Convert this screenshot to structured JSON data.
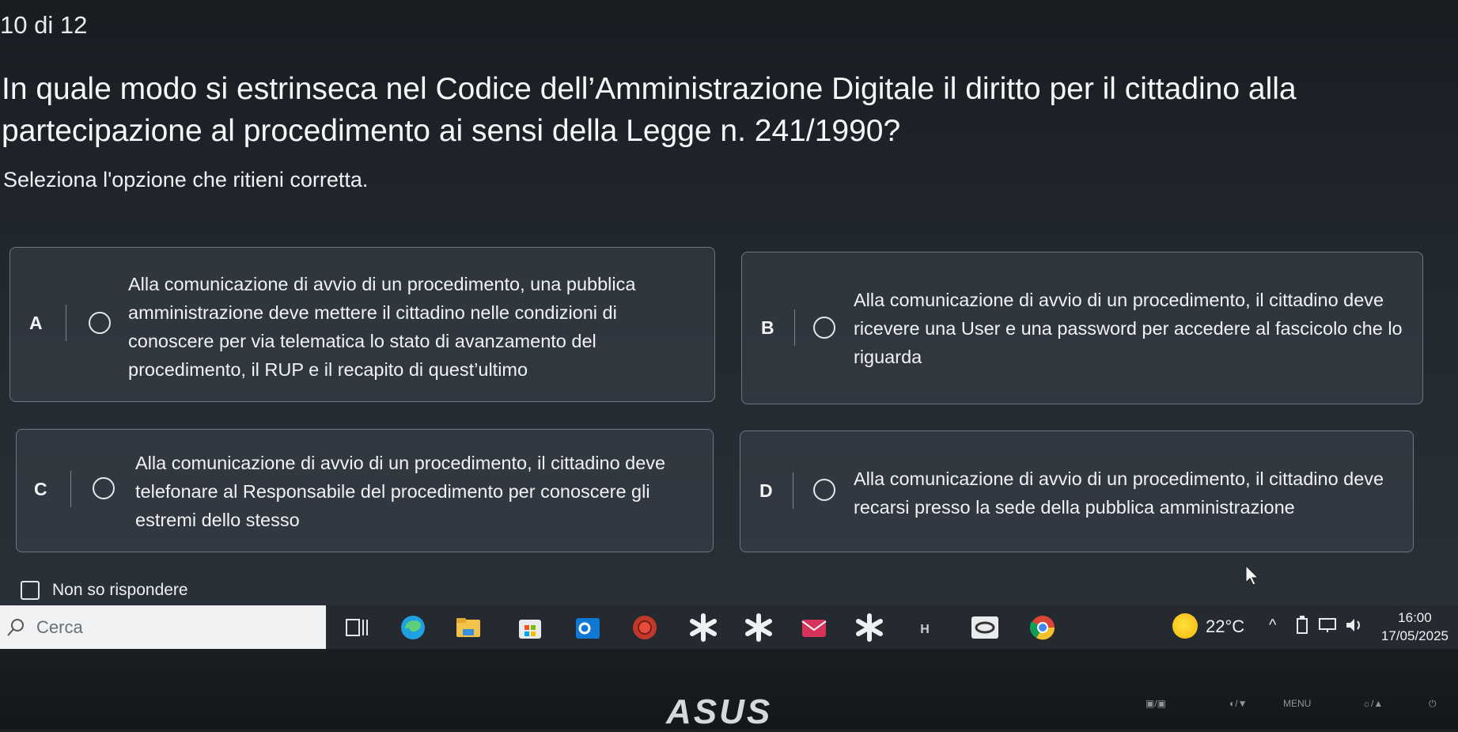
{
  "progress": "10 di 12",
  "question": "In quale modo si estrinseca nel Codice dell’Amministrazione Digitale il diritto per il cittadino alla partecipazione al procedimento ai sensi della Legge n. 241/1990?",
  "instruction": "Seleziona l'opzione che ritieni corretta.",
  "options": [
    {
      "letter": "A",
      "text": "Alla comunicazione di avvio di un procedimento, una pubblica amministrazione deve mettere il cittadino nelle condizioni di conoscere per via telematica lo stato di avanzamento del procedimento, il RUP e il recapito di quest’ultimo"
    },
    {
      "letter": "B",
      "text": "Alla comunicazione di avvio di un procedimento, il cittadino deve ricevere una User e una password per accedere al fascicolo che lo riguarda"
    },
    {
      "letter": "C",
      "text": "Alla comunicazione di avvio di un procedimento, il cittadino deve telefonare al Responsabile del procedimento per conoscere gli estremi dello stesso"
    },
    {
      "letter": "D",
      "text": "Alla comunicazione di avvio di un procedimento, il cittadino deve recarsi presso la sede della pubblica amministrazione"
    }
  ],
  "dont_know_label": "Non so rispondere",
  "taskbar": {
    "search_placeholder": "Cerca",
    "weather_temp": "22°C",
    "time": "16:00",
    "date": "17/05/2025",
    "icons": [
      "task-view-icon",
      "edge-icon",
      "file-explorer-icon",
      "store-icon",
      "outlook-icon",
      "app-icon",
      "snip-icon",
      "snip-icon",
      "mail-icon",
      "snip-icon",
      "app-h-icon",
      "app-icon",
      "chrome-icon"
    ],
    "colors": {
      "edge": "#1fa0e0",
      "explorer": "#f4c34a",
      "store": "#2b8be0",
      "outlook": "#0f78d4",
      "chrome": "#f2c12e"
    }
  },
  "monitor": {
    "brand": "ASUS",
    "buttons": [
      "MENU"
    ]
  }
}
